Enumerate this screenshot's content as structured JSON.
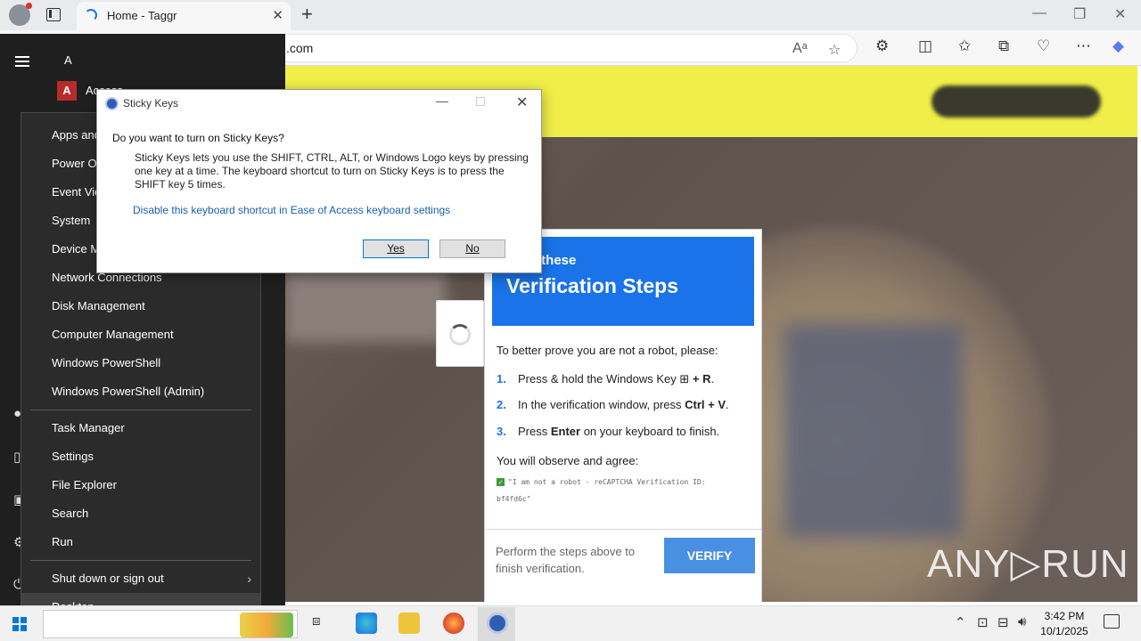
{
  "browser": {
    "tab_title": "Home - Taggr",
    "tab_close": "✕",
    "new_tab": "+",
    "address_suffix": ".com",
    "window_controls": [
      "—",
      "❐",
      "✕"
    ]
  },
  "start_panel": {
    "letter_header": "A",
    "top_app_icon": "A",
    "top_app_label": "Access"
  },
  "context_menu": {
    "group1": [
      "Apps and Features",
      "Power Options",
      "Event Viewer",
      "System",
      "Device Manager",
      "Network Connections",
      "Disk Management",
      "Computer Management",
      "Windows PowerShell",
      "Windows PowerShell (Admin)"
    ],
    "group2": [
      "Task Manager",
      "Settings",
      "File Explorer",
      "Search",
      "Run"
    ],
    "group3": [
      "Shut down or sign out",
      "Desktop"
    ],
    "submenu_arrow": "›"
  },
  "sticky_dialog": {
    "title": "Sticky Keys",
    "question": "Do you want to turn on Sticky Keys?",
    "body": "Sticky Keys lets you use the SHIFT, CTRL, ALT, or Windows Logo keys by pressing one key at a time. The keyboard shortcut to turn on Sticky Keys is to press the SHIFT key 5 times.",
    "link": "Disable this keyboard shortcut in Ease of Access keyboard settings",
    "yes": "Yes",
    "no": "No",
    "minimize": "—",
    "close": "✕"
  },
  "captcha": {
    "header_sub": "plete these",
    "header_title": "Verification Steps",
    "intro": "To better prove you are not a robot, please:",
    "steps": [
      {
        "num": "1.",
        "text_before": "Press & hold the Windows Key ",
        "win_glyph": "⊞",
        "bold": " + R",
        "text_after": "."
      },
      {
        "num": "2.",
        "text_before": "In the verification window, press ",
        "bold": "Ctrl + V",
        "text_after": "."
      },
      {
        "num": "3.",
        "text_before": "Press ",
        "bold": "Enter",
        "text_after": " on your keyboard to finish."
      }
    ],
    "observe": "You will observe and agree:",
    "check_glyph": "✓",
    "check_text": "\"I am not a robot - reCAPTCHA Verification ID: bf4fd6c\"",
    "footer_text": "Perform the steps above to finish verification.",
    "verify_button": "VERIFY"
  },
  "watermark": "ANY▷RUN",
  "taskbar": {
    "time": "3:42 PM",
    "date": "10/1/2025",
    "tray_icons": [
      "chevron-up-icon",
      "meet-now-icon",
      "network-icon",
      "volume-icon"
    ]
  },
  "colors": {
    "accent_blue": "#1a73e8",
    "verify_button": "#4a90e2",
    "banner_yellow": "#f0ee48",
    "menu_bg": "#2b2b2b"
  }
}
